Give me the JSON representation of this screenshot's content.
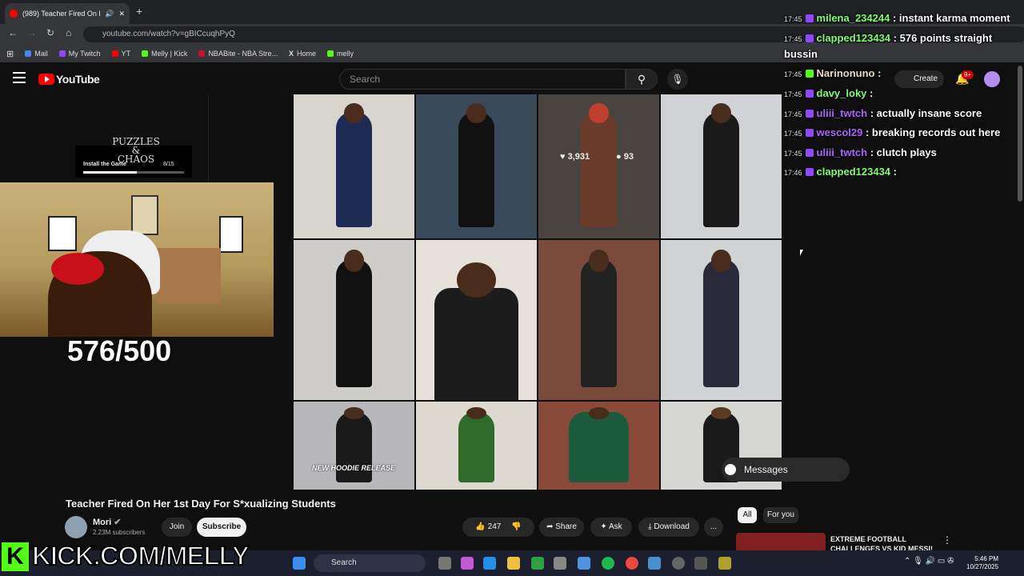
{
  "browser": {
    "tab_title": "(989) Teacher Fired On Her",
    "new_tab": "+",
    "url": "youtube.com/watch?v=gBICcuqhPyQ",
    "bookmarks": [
      {
        "label": "Mail",
        "color": "#4285f4"
      },
      {
        "label": "My Twitch",
        "color": "#9146ff"
      },
      {
        "label": "YT",
        "color": "#ff0000"
      },
      {
        "label": "Melly | Kick",
        "color": "#53fc18"
      },
      {
        "label": "NBABite - NBA Stre...",
        "color": "#c8102e"
      },
      {
        "label": "Home",
        "color": "#ffffff"
      },
      {
        "label": "melly",
        "color": "#53fc18"
      }
    ]
  },
  "youtube": {
    "logo_text": "YouTube",
    "search_placeholder": "Search",
    "create_label": "Create",
    "notif_count": "9+"
  },
  "ad": {
    "brand": "PUZZLES & CHAOS",
    "cta": "Install the Game",
    "counter": "8/15",
    "progress": 0.53
  },
  "stream": {
    "goal_counter": "576/500",
    "kick_logo": "K",
    "kick_url": "KICK.COM/MELLY"
  },
  "post_overlay": {
    "likes": "3,931",
    "comments": "93",
    "caption_bottom": "NEW HOODIE RELEASE",
    "messages_label": "Messages"
  },
  "chat": [
    {
      "time": "17:45",
      "user": "milena_234244",
      "color": "#7dff6e",
      "message": ": instant karma moment"
    },
    {
      "time": "17:45",
      "user": "clapped123434",
      "color": "#7dff6e",
      "message": ": 576 points straight"
    },
    {
      "time": "",
      "user": "",
      "color": "#ffffff",
      "message": "bussin"
    },
    {
      "time": "17:45",
      "user": "Narinonuno",
      "color": "#e8d8c0",
      "message": ":"
    },
    {
      "time": "17:45",
      "user": "davy_loky",
      "color": "#7dff6e",
      "message": ":"
    },
    {
      "time": "17:45",
      "user": "uliii_twtch",
      "color": "#b061ff",
      "message": ": actually insane score"
    },
    {
      "time": "17:45",
      "user": "wescol29",
      "color": "#b061ff",
      "message": ": breaking records out here"
    },
    {
      "time": "17:45",
      "user": "uliii_twtch",
      "color": "#b061ff",
      "message": ": clutch plays"
    },
    {
      "time": "17:46",
      "user": "clapped123434",
      "color": "#7dff6e",
      "message": ":"
    }
  ],
  "video": {
    "title": "Teacher Fired On Her 1st Day For S*xualizing Students",
    "channel": "Mori",
    "subscribers": "2.23M subscribers",
    "join": "Join",
    "subscribe": "Subscribe",
    "likes": "247",
    "share": "Share",
    "ask": "Ask",
    "download": "Download",
    "more": "...",
    "chips": [
      "All",
      "For you"
    ],
    "rec_title": "EXTREME FOOTBALL CHALLENGES VS KID MESSI!"
  },
  "taskbar": {
    "search": "Search",
    "time": "5:46 PM",
    "date": "10/27/2025"
  }
}
